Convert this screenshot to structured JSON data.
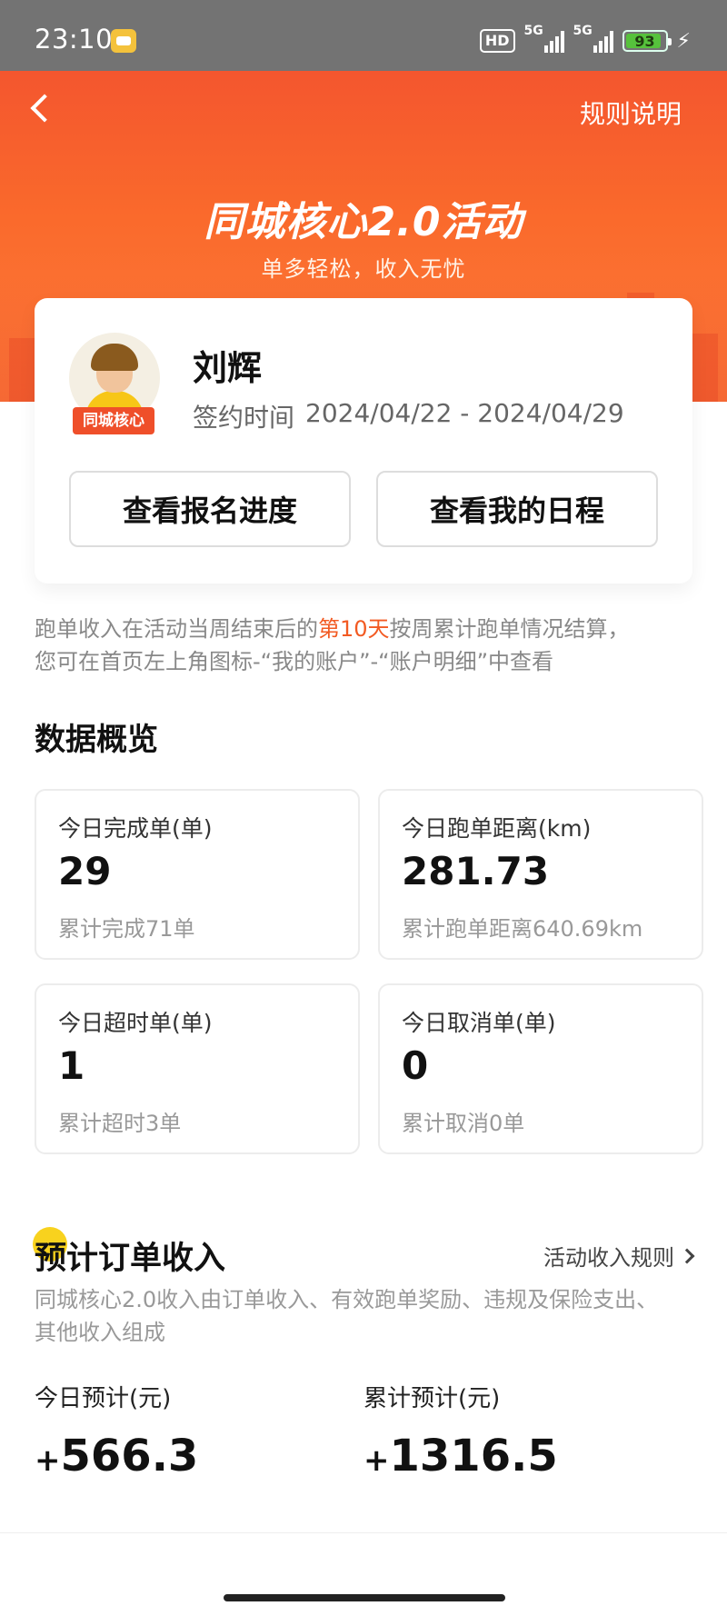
{
  "status_bar": {
    "time": "23:10",
    "hd": "HD",
    "signal1": "5G",
    "signal2": "5G",
    "battery": "93"
  },
  "nav": {
    "rules_label": "规则说明"
  },
  "hero": {
    "title": "同城核心2.0活动",
    "subtitle": "单多轻松，收入无忧"
  },
  "profile": {
    "name": "刘辉",
    "avatar_tag": "同城核心",
    "contract_label": "签约时间",
    "contract_range": "2024/04/22 - 2024/04/29",
    "btn_progress": "查看报名进度",
    "btn_schedule": "查看我的日程"
  },
  "notice": {
    "part1": "跑单收入在活动当周结束后的",
    "highlight": "第10天",
    "part2": "按周累计跑单情况结算，",
    "line2": "您可在首页左上角图标-“我的账户”-“账户明细”中查看"
  },
  "overview": {
    "title": "数据概览",
    "stats": [
      {
        "label": "今日完成单(单)",
        "value": "29",
        "sub": "累计完成71单"
      },
      {
        "label": "今日跑单距离(km)",
        "value": "281.73",
        "sub": "累计跑单距离640.69km"
      },
      {
        "label": "今日超时单(单)",
        "value": "1",
        "sub": "累计超时3单"
      },
      {
        "label": "今日取消单(单)",
        "value": "0",
        "sub": "累计取消0单"
      }
    ]
  },
  "income": {
    "title": "预计订单收入",
    "rule_link": "活动收入规则",
    "description": "同城核心2.0收入由订单收入、有效跑单奖励、违规及保险支出、其他收入组成",
    "today_label": "今日预计(元)",
    "today_sign": "+",
    "today_value": "566.3",
    "total_label": "累计预计(元)",
    "total_sign": "+",
    "total_value": "1316.5"
  },
  "colors": {
    "brand_orange": "#f4562e",
    "highlight": "#f25a22"
  }
}
